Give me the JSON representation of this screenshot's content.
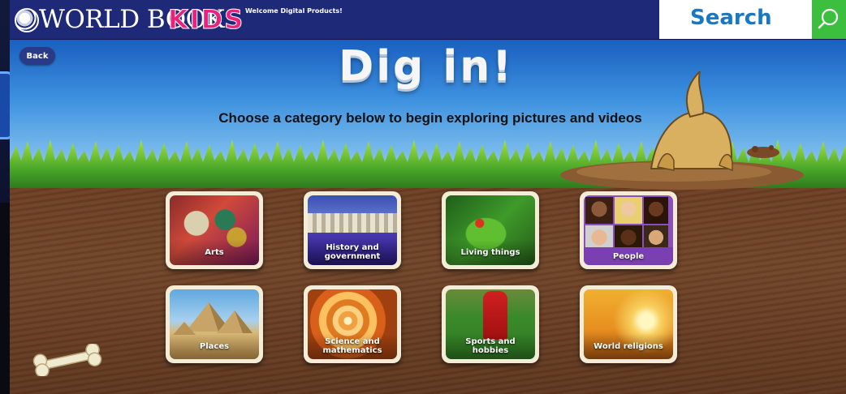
{
  "header": {
    "logo_text": "WORLD BOOK",
    "logo_kids": "KIDS",
    "welcome": "Welcome Digital Products!",
    "search_label": "Search"
  },
  "nav": {
    "back_label": "Back"
  },
  "hero": {
    "title": "Dig in!",
    "subtitle": "Choose a category below to begin exploring pictures and videos"
  },
  "categories": [
    {
      "label": "Arts"
    },
    {
      "label": "History and government"
    },
    {
      "label": "Living things"
    },
    {
      "label": "People"
    },
    {
      "label": "Places"
    },
    {
      "label": "Science and mathematics"
    },
    {
      "label": "Sports and hobbies"
    },
    {
      "label": "World religions"
    }
  ],
  "colors": {
    "header_bg": "#1e2a78",
    "kids_pink": "#e8237e",
    "search_blue": "#1a78c2",
    "search_green": "#3cbf3e",
    "dirt": "#6b3e22"
  },
  "icons": {
    "search": "search-icon",
    "logo": "globe-logo-icon",
    "dog": "dog-illustration",
    "bone": "bone-icon"
  }
}
